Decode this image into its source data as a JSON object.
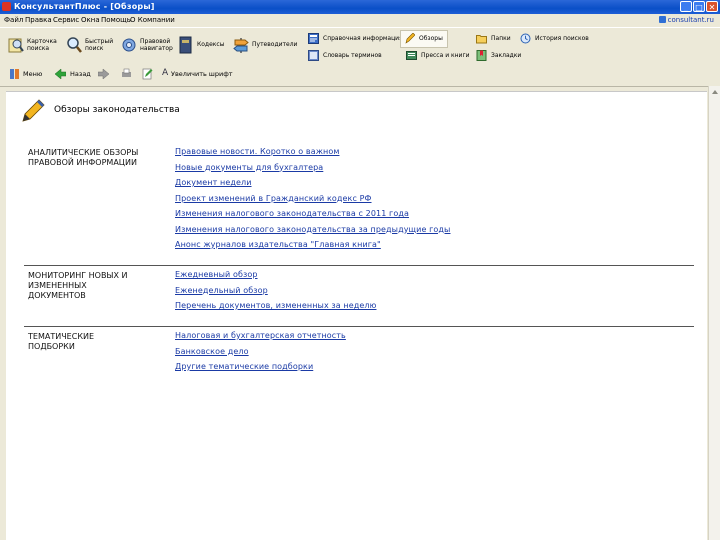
{
  "window": {
    "title": "КонсультантПлюс - [Обзоры]",
    "buttons": {
      "minimize": "_",
      "maximize": "□",
      "close": "✕"
    }
  },
  "menu": {
    "items": [
      "Файл",
      "Правка",
      "Сервис",
      "Окна",
      "Помощь",
      "О Компании"
    ],
    "site_link": "consultant.ru"
  },
  "toolbar1": {
    "items": [
      {
        "label_line1": "Карточка",
        "label_line2": "поиска",
        "icon": "search-card-icon"
      },
      {
        "label_line1": "Быстрый",
        "label_line2": "поиск",
        "icon": "magnifier-icon"
      },
      {
        "label_line1": "Правовой",
        "label_line2": "навигатор",
        "icon": "gear-globe-icon"
      },
      {
        "label_line1": "Кодексы",
        "label_line2": "",
        "icon": "book-icon"
      },
      {
        "label_line1": "Путеводители",
        "label_line2": "",
        "icon": "signpost-icon"
      }
    ],
    "row1": [
      {
        "label": "Справочная информация",
        "icon": "info-icon"
      },
      {
        "label": "Обзоры",
        "icon": "pen-icon",
        "selected": true
      },
      {
        "label": "Папки",
        "icon": "folder-icon"
      },
      {
        "label": "История поисков",
        "icon": "history-icon"
      }
    ],
    "row2": [
      {
        "label": "Словарь терминов",
        "icon": "dictionary-icon"
      },
      {
        "label": "Пресса и книги",
        "icon": "press-icon"
      },
      {
        "label": "Закладки",
        "icon": "bookmark-icon"
      }
    ]
  },
  "toolbar2": {
    "menu_label": "Меню",
    "back_label": "Назад",
    "enlarge_label": "Увеличить шрифт"
  },
  "page": {
    "title": "Обзоры законодательства",
    "sections": [
      {
        "heading_lines": [
          "АНАЛИТИЧЕСКИЕ ОБЗОРЫ",
          "ПРАВОВОЙ ИНФОРМАЦИИ"
        ],
        "links": [
          "Правовые новости. Коротко о важном",
          "Новые документы для бухгалтера",
          "Документ недели",
          "Проект изменений в Гражданский кодекс РФ",
          "Изменения налогового законодательства с 2011 года",
          "Изменения налогового законодательства за предыдущие годы",
          "Анонс журналов издательства \"Главная книга\""
        ]
      },
      {
        "heading_lines": [
          "МОНИТОРИНГ НОВЫХ И",
          "ИЗМЕНЕННЫХ",
          "ДОКУМЕНТОВ"
        ],
        "links": [
          "Ежедневный обзор",
          "Еженедельный обзор",
          "Перечень документов, измененных за неделю"
        ]
      },
      {
        "heading_lines": [
          "ТЕМАТИЧЕСКИЕ",
          "ПОДБОРКИ"
        ],
        "links": [
          "Налоговая и бухгалтерская отчетность",
          "Банковское дело",
          "Другие тематические подборки"
        ]
      }
    ]
  }
}
